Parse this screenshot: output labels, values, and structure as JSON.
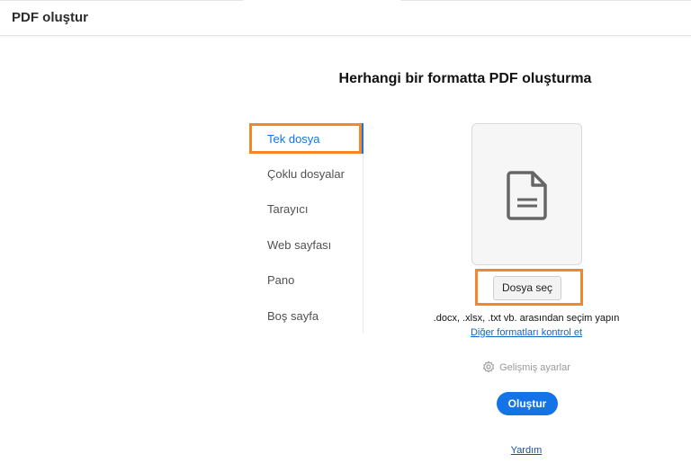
{
  "header": {
    "title": "PDF oluştur"
  },
  "main": {
    "title": "Herhangi bir formatta PDF oluşturma"
  },
  "sidebar": {
    "items": [
      {
        "label": "Tek dosya",
        "active": true
      },
      {
        "label": "Çoklu dosyalar"
      },
      {
        "label": "Tarayıcı"
      },
      {
        "label": "Web sayfası"
      },
      {
        "label": "Pano"
      },
      {
        "label": "Boş sayfa"
      }
    ]
  },
  "upload": {
    "icon": "document-icon",
    "choose_file": "Dosya seç",
    "formats_hint": ".docx, .xlsx, .txt vb. arasından seçim yapın",
    "other_formats_link": "Diğer formatları kontrol et"
  },
  "advanced": {
    "label": "Gelişmiş ayarlar",
    "icon": "gear-icon"
  },
  "create_button": "Oluştur",
  "help_link": "Yardım",
  "colors": {
    "accent": "#1473e6",
    "highlight": "#f5862a"
  }
}
